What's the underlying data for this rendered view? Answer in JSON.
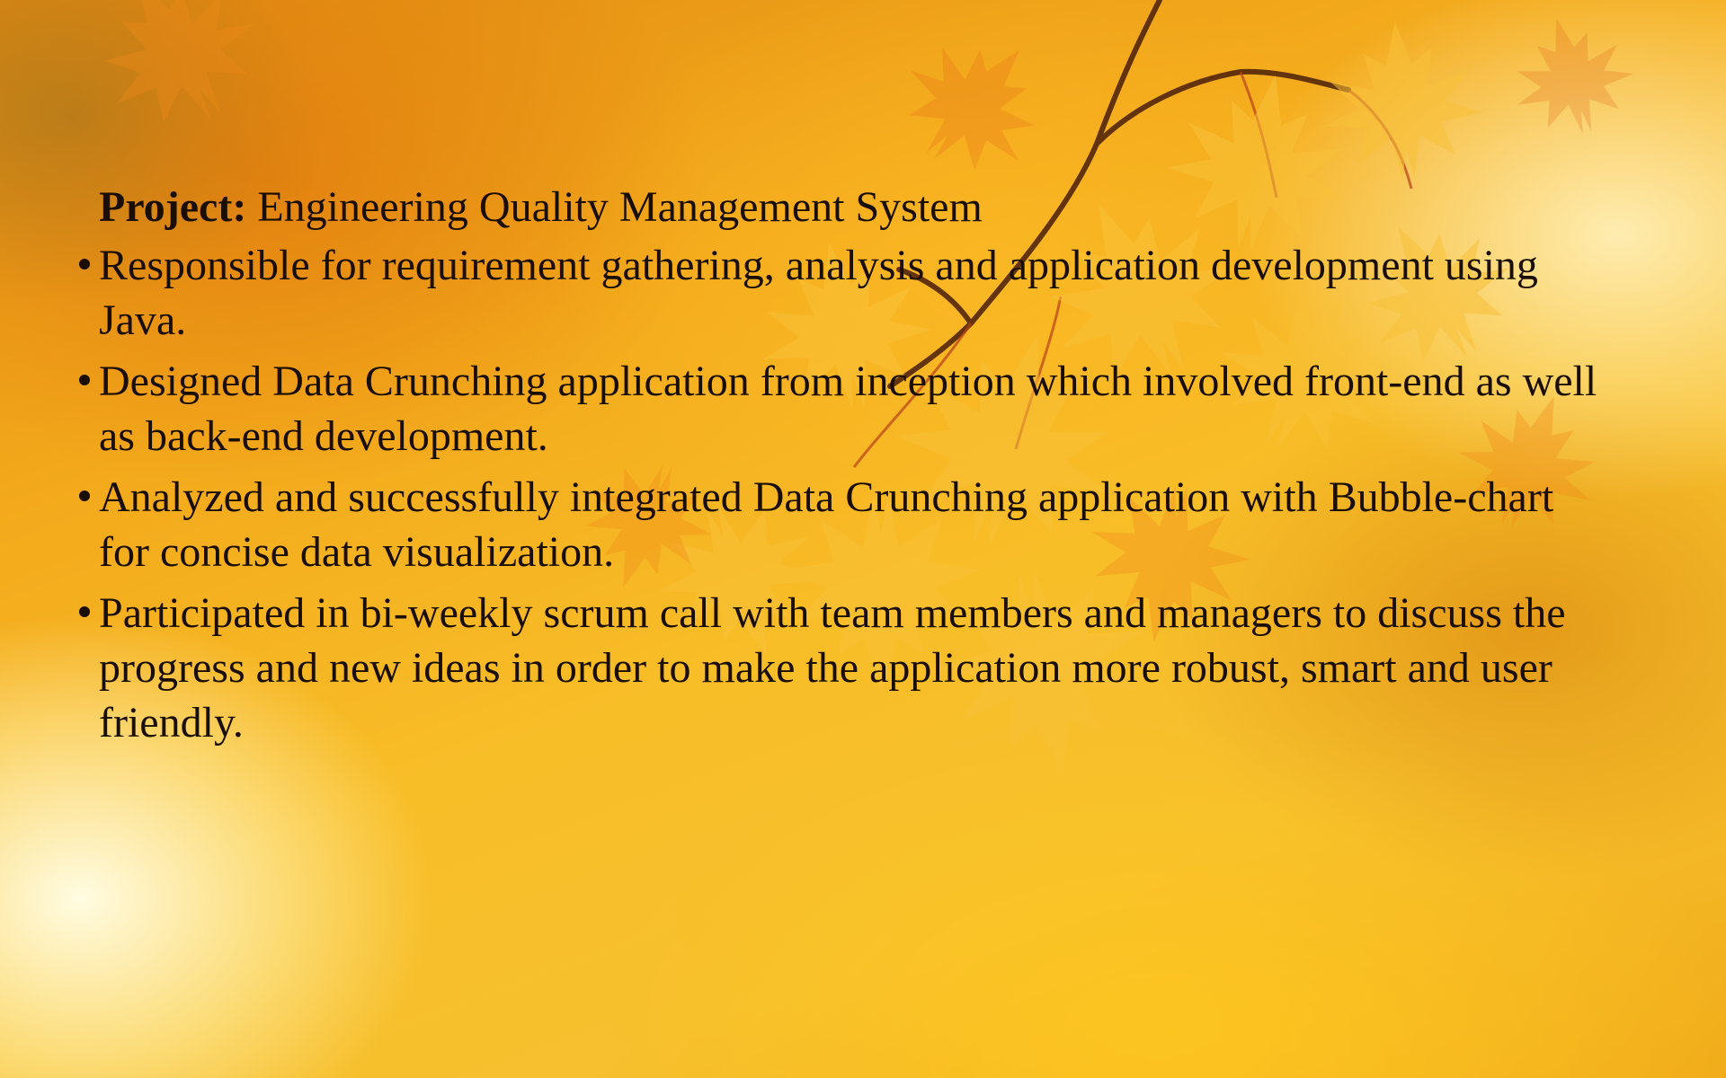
{
  "slide": {
    "project_label": "Project:",
    "project_name": "Engineering Quality Management System",
    "bullets": [
      "Responsible for requirement gathering, analysis and application development using Java.",
      "Designed Data Crunching application from inception which involved front-end as well as back-end development.",
      "Analyzed and successfully integrated Data Crunching application with Bubble-chart for concise data visualization.",
      "Participated in bi-weekly scrum call with team members and managers to discuss the progress and new ideas in order to make the application more robust, smart and user friendly."
    ]
  },
  "colors": {
    "background_primary": "#f3a91b",
    "background_light": "#fff3c4",
    "leaf_color": "#f7b52a",
    "branch_color": "#4a1e08",
    "text_color": "#1a0e00"
  }
}
